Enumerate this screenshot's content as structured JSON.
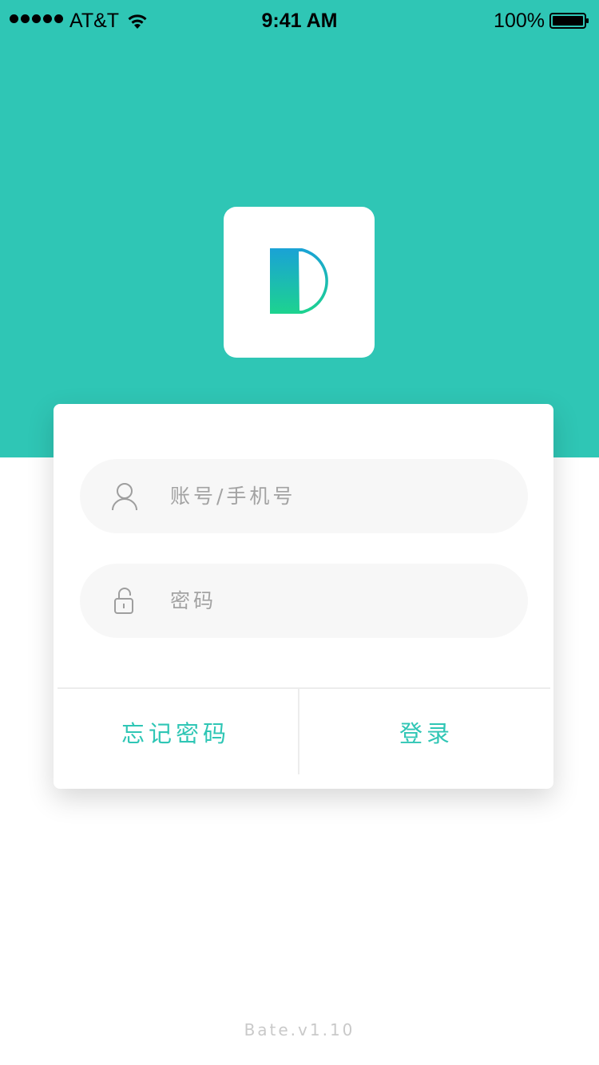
{
  "status_bar": {
    "carrier": "AT&T",
    "time": "9:41 AM",
    "battery": "100%"
  },
  "logo": {
    "letter": "D",
    "gradient_top": "#1aa2d6",
    "gradient_bottom": "#1dd38f"
  },
  "login": {
    "account_placeholder": "账号/手机号",
    "password_placeholder": "密码",
    "forgot_label": "忘记密码",
    "login_label": "登录"
  },
  "footer": {
    "version": "Bate.v1.10"
  },
  "colors": {
    "accent": "#2fc6b5",
    "field_bg": "#f7f7f7",
    "placeholder": "#a3a3a3"
  }
}
